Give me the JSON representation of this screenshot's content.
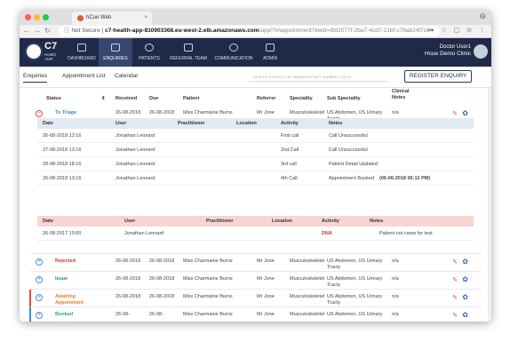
{
  "browser": {
    "tab_title": "hCue Web",
    "tab_close": "×",
    "not_secure": "Not Secure",
    "url_host": "c7-health-app-810903368.eu-west-2.elb.amazonaws.com",
    "url_path": "/app/?#/appointment?kwid=8fd2077f-2ba7-4cd7-21bf-c76ab24f7c84",
    "nav_back": "←",
    "nav_forward": "→",
    "reload": "↻",
    "ext_icons": "⊶ ☆ ▢ ⊙ ⋮",
    "profile": "⊖"
  },
  "app": {
    "logo_title": "C7",
    "logo_sub": "Health AMP",
    "nav": [
      {
        "label": "DASHBOARD"
      },
      {
        "label": "ENQUIRIES"
      },
      {
        "label": "PATIENTS"
      },
      {
        "label": "REFERRAL TEAM"
      },
      {
        "label": "COMMUNICATION"
      },
      {
        "label": "ADMIN"
      }
    ],
    "user_name": "Doctor User1",
    "user_org": "Hcue Demo Clinic"
  },
  "subnav": {
    "tabs": [
      "Enquiries",
      "Appointment List",
      "Calendar"
    ],
    "search_placeholder": "SEARCH A PATIENT BY NAME/CONTACT NUMBER / DW ID",
    "register_label": "REGISTER ENQUIRY"
  },
  "table": {
    "headers": {
      "status": "Status",
      "sort": "⇕",
      "received": "Received",
      "due": "Due",
      "patient": "Patient",
      "referrer": "Referrer",
      "speciality": "Speciality",
      "sub_speciality": "Sub Speciality",
      "clinical_notes": "Clinical Notes"
    },
    "first_row": {
      "status": "To Triage",
      "received": "26-08-2018",
      "due": "26-08-2018",
      "patient": "Miss Charmaine Burns",
      "referrer": "Mr Jone",
      "speciality": "Musculoskeletel",
      "sub_speciality": "US Abdomen, US Urinary Tracty",
      "notes": "n/a"
    },
    "rows": [
      {
        "status": "Rejected",
        "received": "26-08-2018",
        "due": "26-08-2018",
        "patient": "Miss Charmaine Burns",
        "referrer": "Mr Jone",
        "speciality": "Musculoskeletel",
        "sub_speciality": "US Abdomen, US Urinary Tracty",
        "notes": "n/a",
        "color": "#c0392b"
      },
      {
        "status": "Issue",
        "received": "26-08-2018",
        "due": "26-08-2018",
        "patient": "Miss Charmaine Burns",
        "referrer": "Mr Jone",
        "speciality": "Musculoskeletel",
        "sub_speciality": "US Abdomen, US Urinary Tracty",
        "notes": "n/a",
        "color": "#1a8a7a"
      },
      {
        "status": "Awaiting Appoinment",
        "received": "26-08-2018",
        "due": "26-08-2018",
        "patient": "Miss Charmaine Burns",
        "referrer": "Mr Jone",
        "speciality": "Musculoskeletel",
        "sub_speciality": "US Abdomen, US Urinary Tracty",
        "notes": "n/a",
        "color": "#e67e22"
      },
      {
        "status": "Booked",
        "received": "26-08-",
        "due": "26-08-",
        "patient": "Miss Charmaine Burns",
        "referrer": "Mr Jone",
        "speciality": "Musculoskeletel",
        "sub_speciality": "US Abdomen, US Urinary",
        "notes": "n/a",
        "color": "#27ae60"
      }
    ]
  },
  "activity": {
    "headers": {
      "date": "Date",
      "user": "User",
      "practitioner": "Practitioner",
      "location": "Location",
      "activity": "Activity",
      "notes": "Notes"
    },
    "rows": [
      {
        "date": "26-08-2018 13:16",
        "user": "Jonathan Leonard",
        "activity": "First call",
        "notes": "Call Unsuccessful",
        "bold": ""
      },
      {
        "date": "27-08-2018 13:16",
        "user": "Jonathan Leonard",
        "activity": "2nd Call",
        "notes": "Call Unsuccessful",
        "bold": ""
      },
      {
        "date": "28-08-2018 18:16",
        "user": "Jonathan Leonard",
        "activity": "3rd call",
        "notes": "Patient Detail Updated",
        "bold": ""
      },
      {
        "date": "26-08-2018 13:16",
        "user": "Jonathan Leonard",
        "activity": "4th Call",
        "notes": "Appointment Booked",
        "bold": "(06-06-2018 06:12 PM)"
      }
    ]
  },
  "dna": {
    "headers": {
      "date": "Date",
      "user": "User",
      "practitioner": "Practitioner",
      "location": "Location",
      "activity": "Activity",
      "notes": "Notes"
    },
    "row": {
      "date": "26-08-2017 10:00",
      "user": "Jonathan Leonard",
      "activity": "DNA",
      "notes": "Patient not came for test"
    }
  },
  "icons": {
    "pin": "✎",
    "gear": "✿",
    "plus": "+",
    "minus": "−"
  }
}
